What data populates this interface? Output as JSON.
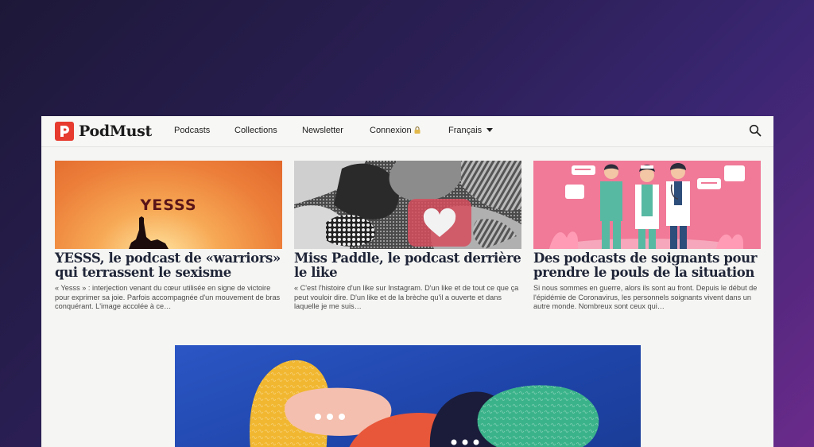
{
  "brand": {
    "name": "PodMust",
    "logo_letter_icon": "p-logo-icon"
  },
  "nav": {
    "items": [
      "Podcasts",
      "Collections",
      "Newsletter"
    ],
    "login": "Connexion",
    "login_icon": "lock-icon",
    "language": "Français",
    "search_icon": "search-icon"
  },
  "cards": [
    {
      "image_text": "YESSS",
      "title": "YESSS, le podcast de «warriors» qui terrassent le sexisme",
      "description": "« Yesss » : interjection venant du cœur utilisée en signe de victoire pour exprimer sa joie. Parfois accompagnée d'un mouvement de bras conquérant. L'image accolée à ce…"
    },
    {
      "image_icon": "heart-icon",
      "title": "Miss Paddle, le podcast derrière le like",
      "description": "« C'est l'histoire d'un like sur Instagram. D'un like et de tout ce que ça peut vouloir dire. D'un like et de la brèche qu'il a ouverte et dans laquelle je me suis…"
    },
    {
      "title": "Des podcasts de soignants pour prendre le pouls de la situation",
      "description": "Si nous sommes en guerre, alors ils sont au front. Depuis le début de l'épidémie de Coronavirus, les personnels soignants vivent dans un autre monde. Nombreux sont ceux qui…"
    }
  ],
  "colors": {
    "brand_red": "#e63b2e",
    "title_navy": "#1f2537",
    "banner_blue": "#1e44a8"
  }
}
